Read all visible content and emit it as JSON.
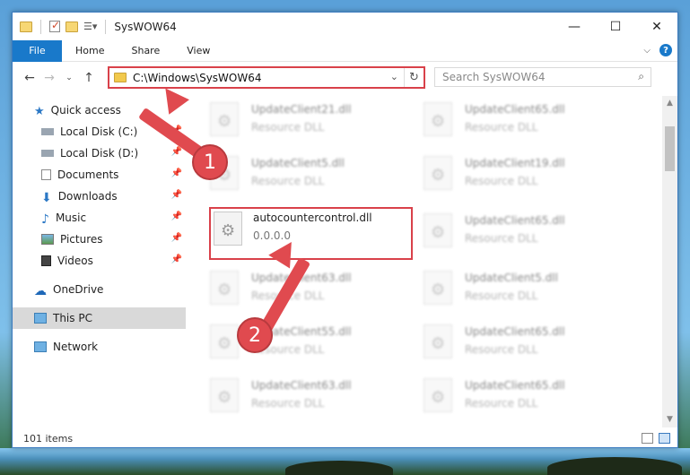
{
  "window": {
    "title": "SysWOW64"
  },
  "ribbon": {
    "file": "File",
    "tabs": [
      "Home",
      "Share",
      "View"
    ]
  },
  "address": {
    "path": "C:\\Windows\\SysWOW64"
  },
  "search": {
    "placeholder": "Search SysWOW64"
  },
  "nav": {
    "items": [
      {
        "label": "Quick access",
        "icon": "star-icon",
        "pinned": false
      },
      {
        "label": "Local Disk (C:)",
        "icon": "drive-icon",
        "pinned": true
      },
      {
        "label": "Local Disk (D:)",
        "icon": "drive-icon",
        "pinned": true
      },
      {
        "label": "Documents",
        "icon": "documents-icon",
        "pinned": true
      },
      {
        "label": "Downloads",
        "icon": "download-icon",
        "pinned": true
      },
      {
        "label": "Music",
        "icon": "music-icon",
        "pinned": true
      },
      {
        "label": "Pictures",
        "icon": "pictures-icon",
        "pinned": true
      },
      {
        "label": "Videos",
        "icon": "videos-icon",
        "pinned": true
      },
      {
        "label": "OneDrive",
        "icon": "cloud-icon",
        "pinned": false
      },
      {
        "label": "This PC",
        "icon": "computer-icon",
        "pinned": false,
        "selected": true
      },
      {
        "label": "Network",
        "icon": "network-icon",
        "pinned": false
      }
    ]
  },
  "files": {
    "left": [
      {
        "name": "UpdateClient21.dll",
        "type": "Resource DLL"
      },
      {
        "name": "UpdateClient5.dll",
        "type": "Resource DLL"
      },
      {
        "name": "autocountercontrol.dll",
        "type": "0.0.0.0",
        "highlighted": true
      },
      {
        "name": "UpdateClient63.dll",
        "type": "Resource DLL"
      },
      {
        "name": "UpdateClient55.dll",
        "type": "Resource DLL"
      },
      {
        "name": "UpdateClient63.dll",
        "type": "Resource DLL"
      }
    ],
    "right": [
      {
        "name": "UpdateClient65.dll",
        "type": "Resource DLL"
      },
      {
        "name": "UpdateClient19.dll",
        "type": "Resource DLL"
      },
      {
        "name": "UpdateClient65.dll",
        "type": "Resource DLL"
      },
      {
        "name": "UpdateClient5.dll",
        "type": "Resource DLL"
      },
      {
        "name": "UpdateClient65.dll",
        "type": "Resource DLL"
      },
      {
        "name": "UpdateClient65.dll",
        "type": "Resource DLL"
      }
    ]
  },
  "status": {
    "count": "101 items"
  },
  "callouts": {
    "one": "1",
    "two": "2"
  },
  "colors": {
    "accent": "#1979ca",
    "highlight": "#d9414a",
    "callout": "#e04a4f"
  }
}
